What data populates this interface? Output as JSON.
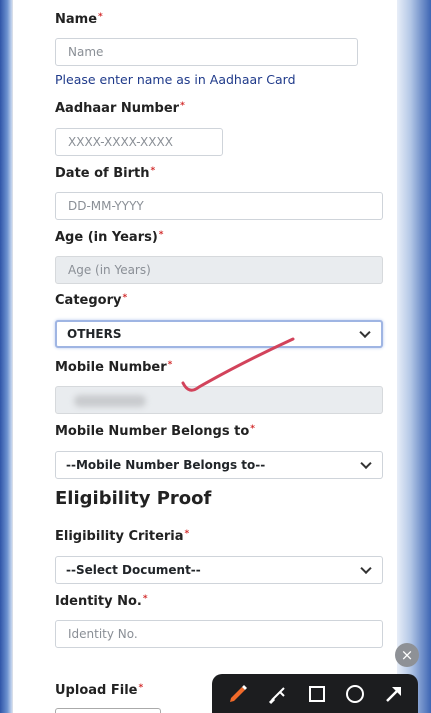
{
  "form": {
    "name": {
      "label": "Name",
      "placeholder": "Name",
      "hint": "Please enter name as in Aadhaar Card"
    },
    "aadhaar": {
      "label": "Aadhaar Number",
      "placeholder": "XXXX-XXXX-XXXX"
    },
    "dob": {
      "label": "Date of Birth",
      "placeholder": "DD-MM-YYYY"
    },
    "age": {
      "label": "Age (in Years)",
      "placeholder": "Age (in Years)"
    },
    "category": {
      "label": "Category",
      "selected": "OTHERS"
    },
    "mobile": {
      "label": "Mobile Number"
    },
    "mobile_belongs": {
      "label": "Mobile Number Belongs to",
      "selected": "--Mobile Number Belongs to--"
    },
    "required_mark": "*"
  },
  "eligibility": {
    "heading": "Eligibility Proof",
    "criteria": {
      "label": "Eligibility Criteria",
      "selected": "--Select Document--"
    },
    "identity": {
      "label": "Identity No.",
      "placeholder": "Identity No."
    },
    "upload": {
      "label": "Upload File"
    }
  },
  "overlay": {
    "close_glyph": "×",
    "tools": [
      "pen-icon",
      "highlighter-icon",
      "rectangle-icon",
      "circle-icon",
      "arrow-icon"
    ],
    "annotation_color": "#d2435b",
    "accent_pen_color": "#f06a2a"
  }
}
